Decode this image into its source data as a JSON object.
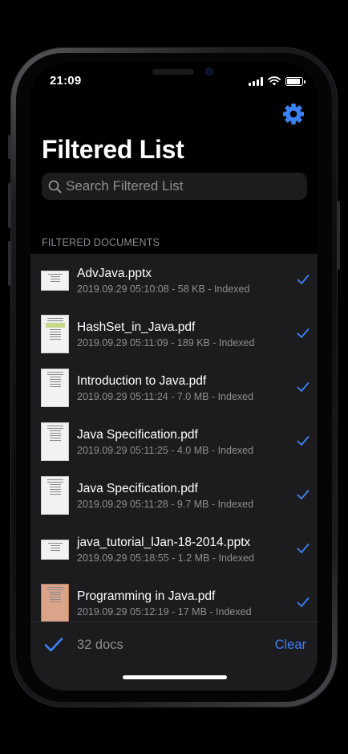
{
  "status_bar": {
    "time": "21:09",
    "battery_level": 0.9,
    "signal_icon": "cellular-signal-icon",
    "wifi_icon": "wifi-icon",
    "battery_icon": "battery-icon"
  },
  "header": {
    "settings_icon": "gear-icon",
    "title": "Filtered List"
  },
  "search": {
    "placeholder": "Search Filtered List",
    "icon": "magnifying-glass-icon"
  },
  "section": {
    "header": "FILTERED DOCUMENTS"
  },
  "documents": [
    {
      "name": "AdvJava.pptx",
      "meta": "2019.09.29 05:10:08 - 58 KB -  Indexed",
      "selected": true,
      "thumb": "landscape"
    },
    {
      "name": "HashSet_in_Java.pdf",
      "meta": "2019.09.29 05:11:09 - 189 KB -  Indexed",
      "selected": true,
      "thumb": "portrait-chart"
    },
    {
      "name": "Introduction to Java.pdf",
      "meta": "2019.09.29 05:11:24 - 7.0 MB -  Indexed",
      "selected": true,
      "thumb": "portrait"
    },
    {
      "name": "Java Specification.pdf",
      "meta": "2019.09.29 05:11:25 - 4.0 MB -  Indexed",
      "selected": true,
      "thumb": "portrait"
    },
    {
      "name": "Java Specification.pdf",
      "meta": "2019.09.29 05:11:28 - 9.7 MB -  Indexed",
      "selected": true,
      "thumb": "portrait"
    },
    {
      "name": "java_tutorial_lJan-18-2014.pptx",
      "meta": "2019.09.29 05:18:55 - 1.2 MB -  Indexed",
      "selected": true,
      "thumb": "landscape"
    },
    {
      "name": "Programming in Java.pdf",
      "meta": "2019.09.29 05:12:19 - 17 MB -  Indexed",
      "selected": true,
      "thumb": "portrait-colored"
    }
  ],
  "toolbar": {
    "select_icon": "checkmark-icon",
    "count_label": "32 docs",
    "clear_label": "Clear"
  },
  "colors": {
    "accent": "#3b82f6",
    "background": "#000000",
    "list_background": "#1c1c1e",
    "secondary_text": "#8e8e93"
  }
}
